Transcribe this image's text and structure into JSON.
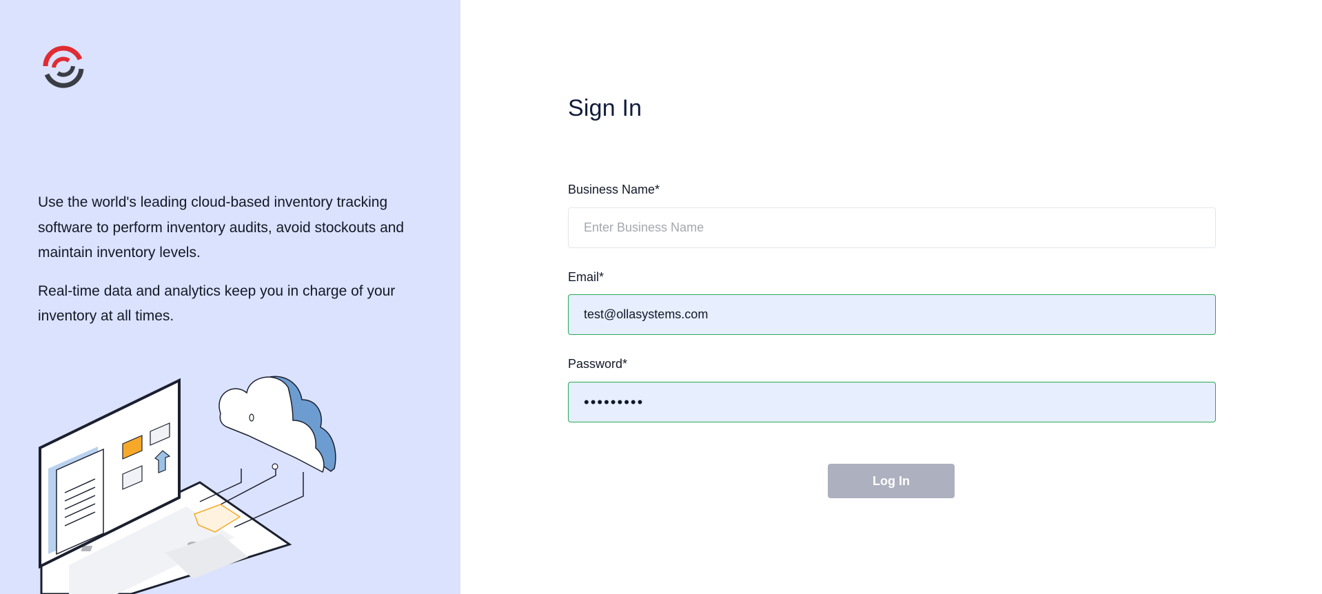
{
  "brand": {
    "logo_icon": "ollasystems-logo-icon",
    "colors": {
      "red": "#e02b32",
      "dark": "#3a3d44"
    }
  },
  "left": {
    "paragraph_1": "Use the world's leading cloud-based inventory tracking software to perform inventory audits, avoid stockouts and maintain inventory levels.",
    "paragraph_2": "Real-time data and analytics keep you in charge of your inventory at all times.",
    "illustration_icon": "laptop-cloud-illustration"
  },
  "form": {
    "title": "Sign In",
    "business_name": {
      "label": "Business Name*",
      "placeholder": "Enter Business Name",
      "value": ""
    },
    "email": {
      "label": "Email*",
      "value": "test@ollasystems.com"
    },
    "password": {
      "label": "Password*",
      "value": "•••••••••"
    },
    "login_label": "Log In"
  },
  "colors": {
    "left_panel_bg": "#dbe2fd",
    "input_filled_bg": "#e7eefd",
    "input_filled_border": "#27a957",
    "button_disabled_bg": "#adb0bf"
  }
}
